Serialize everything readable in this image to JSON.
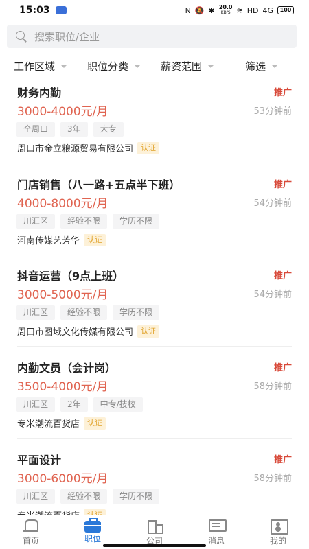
{
  "status": {
    "time": "15:03",
    "speed_value": "20.0",
    "speed_unit": "KB/S",
    "battery": "100",
    "hd": "HD",
    "net": "4G"
  },
  "search": {
    "placeholder": "搜索职位/企业"
  },
  "filters": [
    "工作区域",
    "职位分类",
    "薪资范围",
    "筛选"
  ],
  "jobs": [
    {
      "title": "财务内勤",
      "promo": "推广",
      "salary": "3000-4000元/月",
      "time": "53分钟前",
      "tags": [
        "全周口",
        "3年",
        "大专"
      ],
      "company": "周口市金立粮源贸易有限公司",
      "cert": "认证"
    },
    {
      "title": "门店销售（八一路+五点半下班）",
      "promo": "推广",
      "salary": "4000-8000元/月",
      "time": "54分钟前",
      "tags": [
        "川汇区",
        "经验不限",
        "学历不限"
      ],
      "company": "河南传媒艺芳华",
      "cert": "认证"
    },
    {
      "title": "抖音运营（9点上班）",
      "promo": "推广",
      "salary": "3000-5000元/月",
      "time": "54分钟前",
      "tags": [
        "川汇区",
        "经验不限",
        "学历不限"
      ],
      "company": "周口市图域文化传媒有限公司",
      "cert": "认证"
    },
    {
      "title": "内勤文员（会计岗）",
      "promo": "推广",
      "salary": "3500-4000元/月",
      "time": "58分钟前",
      "tags": [
        "川汇区",
        "2年",
        "中专/技校"
      ],
      "company": "专米潮流百货店",
      "cert": "认证"
    },
    {
      "title": "平面设计",
      "promo": "推广",
      "salary": "3000-6000元/月",
      "time": "58分钟前",
      "tags": [
        "川汇区",
        "经验不限",
        "学历不限"
      ],
      "company": "专米潮流百货店",
      "cert": "认证"
    }
  ],
  "tabs": [
    {
      "label": "首页",
      "icon": "home-icon"
    },
    {
      "label": "职位",
      "icon": "briefcase-icon"
    },
    {
      "label": "公司",
      "icon": "building-icon"
    },
    {
      "label": "消息",
      "icon": "message-icon"
    },
    {
      "label": "我的",
      "icon": "profile-icon"
    }
  ],
  "colors": {
    "accent": "#2a78d8",
    "salary": "#e06451",
    "promo": "#d84a3a",
    "cert_bg": "#fdf1d8",
    "cert_text": "#e0a22a"
  }
}
